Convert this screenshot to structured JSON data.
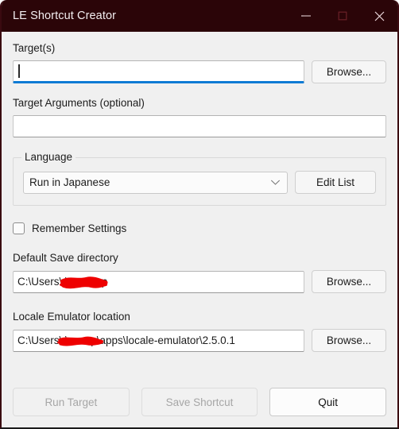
{
  "window": {
    "title": "LE Shortcut Creator",
    "titlebar_color": "#2b0508",
    "accent_color": "#0f7bd4",
    "redaction_color": "#ee0000",
    "controls": {
      "minimize": "minimize",
      "maximize": "maximize",
      "close": "close"
    }
  },
  "form": {
    "target": {
      "label": "Target(s)",
      "value": "",
      "placeholder": "",
      "browse_label": "Browse...",
      "focused": true
    },
    "target_arguments": {
      "label": "Target Arguments (optional)",
      "value": "",
      "placeholder": ""
    },
    "language": {
      "group_label": "Language",
      "selected": "Run in Japanese",
      "options": [
        "Run in Japanese"
      ],
      "edit_list_label": "Edit List"
    },
    "remember_settings": {
      "label": "Remember Settings",
      "checked": false
    },
    "default_save_directory": {
      "label": "Default Save directory",
      "value": "C:\\Users\\               \\Desktop",
      "value_prefix": "C:\\Users\\",
      "value_suffix": "\\Desktop",
      "browse_label": "Browse..."
    },
    "locale_emulator_location": {
      "label": "Locale Emulator location",
      "value": "C:\\Users\\               \\scoop\\apps\\locale-emulator\\2.5.0.1",
      "value_prefix": "C:\\Users\\",
      "value_suffix": "\\scoop\\apps\\locale-emulator\\2.5.0.1",
      "browse_label": "Browse..."
    }
  },
  "footer": {
    "run_target_label": "Run Target",
    "save_shortcut_label": "Save Shortcut",
    "quit_label": "Quit",
    "run_target_enabled": false,
    "save_shortcut_enabled": false,
    "quit_enabled": true
  }
}
